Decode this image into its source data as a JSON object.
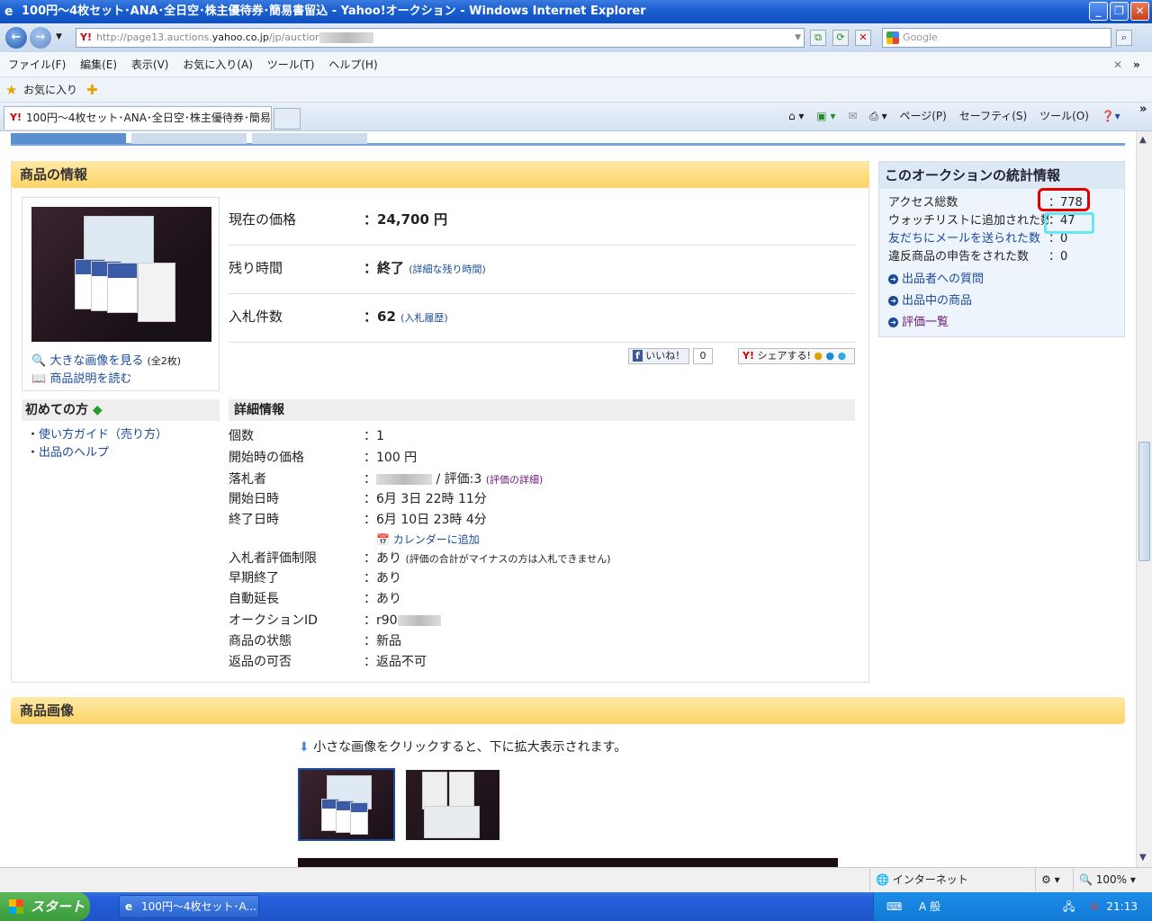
{
  "window": {
    "title": "100円～4枚セット･ANA･全日空･株主優待券･簡易書留込 - Yahoo!オークション - Windows Internet Explorer",
    "controls": [
      "_",
      "❐",
      "✕"
    ]
  },
  "address": {
    "url_prefix": "http://page13.auctions.",
    "url_host": "yahoo.co.jp",
    "url_suffix": "/jp/auctior",
    "search_placeholder": "Google"
  },
  "menu": [
    "ファイル(F)",
    "編集(E)",
    "表示(V)",
    "お気に入り(A)",
    "ツール(T)",
    "ヘルプ(H)"
  ],
  "favorites": {
    "label": "お気に入り"
  },
  "tab": {
    "title": "100円～4枚セット･ANA･全日空･株主優待券･簡易..."
  },
  "commandbar": [
    "ページ(P)",
    "セーフティ(S)",
    "ツール(O)"
  ],
  "product": {
    "section_title": "商品の情報",
    "large_image_link": "大きな画像を見る",
    "large_image_count": "(全2枚)",
    "read_description": "商品説明を読む",
    "price_label": "現在の価格",
    "price_value": "24,700 円",
    "time_label": "残り時間",
    "time_value": "終了",
    "time_link": "(詳細な残り時間)",
    "bids_label": "入札件数",
    "bids_value": "62",
    "bids_link": "(入札履歴)",
    "like_label": "いいね！",
    "like_count": "0",
    "share_label": "シェアする!",
    "beginner_title": "初めての方",
    "beginner_links": [
      "使い方ガイド（売り方）",
      "出品のヘルプ"
    ],
    "details_title": "詳細情報",
    "details": [
      {
        "k": "個数",
        "v": "1"
      },
      {
        "k": "開始時の価格",
        "v": "100 円"
      },
      {
        "k": "落札者",
        "v": "/ 評価:3",
        "link": "(評価の詳細)"
      },
      {
        "k": "開始日時",
        "v": "6月 3日 22時 11分"
      },
      {
        "k": "終了日時",
        "v": "6月 10日 23時 4分"
      },
      {
        "k": "入札者評価制限",
        "v": "あり",
        "note": "(評価の合計がマイナスの方は入札できません)"
      },
      {
        "k": "早期終了",
        "v": "あり"
      },
      {
        "k": "自動延長",
        "v": "あり"
      },
      {
        "k": "オークションID",
        "v": "r90"
      },
      {
        "k": "商品の状態",
        "v": "新品"
      },
      {
        "k": "返品の可否",
        "v": "返品不可"
      }
    ],
    "calendar_link": "カレンダーに追加"
  },
  "stats": {
    "title": "このオークションの統計情報",
    "rows": [
      {
        "k": "アクセス総数",
        "v": "778"
      },
      {
        "k": "ウォッチリストに追加された数",
        "v": "47"
      },
      {
        "k": "友だちにメールを送られた数",
        "v": "0"
      },
      {
        "k": "違反商品の申告をされた数",
        "v": "0"
      }
    ],
    "links": [
      "出品者への質問",
      "出品中の商品",
      "評価一覧"
    ]
  },
  "images": {
    "section_title": "商品画像",
    "hint": "小さな画像をクリックすると、下に拡大表示されます。"
  },
  "status": {
    "zone": "インターネット",
    "zoom": "100%"
  },
  "taskbar": {
    "start": "スタート",
    "item": "100円～4枚セット･A...",
    "clock": "21:13",
    "ime": "A 般"
  },
  "colors": {
    "highlight_red": "#e00000",
    "highlight_cyan": "#66e6f0",
    "header_gold": "#fcd466"
  }
}
